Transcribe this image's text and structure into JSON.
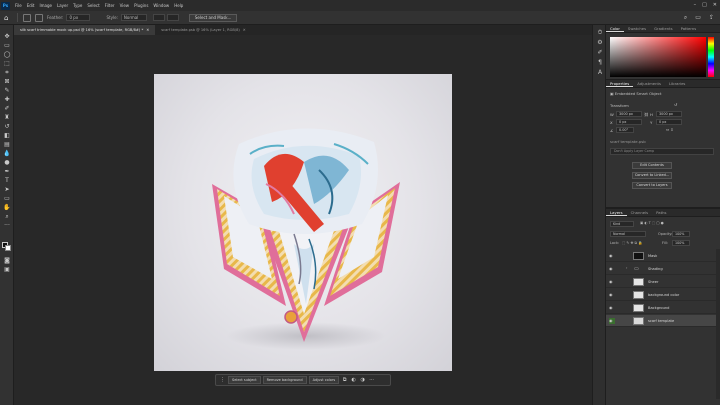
{
  "menubar": {
    "logo": "Ps",
    "items": [
      "File",
      "Edit",
      "Image",
      "Layer",
      "Type",
      "Select",
      "Filter",
      "View",
      "Plugins",
      "Window",
      "Help"
    ]
  },
  "options": {
    "feather_label": "Feather:",
    "feather_value": "0 px",
    "style_label": "Style:",
    "style_value": "Normal",
    "select_mask_label": "Select and Mask..."
  },
  "tabs": [
    {
      "label": "silk scarf trimmable mock up.psd @ 16% (scarf template, RGB/8#) *",
      "active": true
    },
    {
      "label": "scarf template.psb @ 16% (Layer 1, RGB/8)",
      "active": false
    }
  ],
  "context_bar": {
    "select_subject": "Select subject",
    "remove_background": "Remove background",
    "adjust_colors": "Adjust colors",
    "more": "···"
  },
  "color_panel": {
    "tabs": [
      "Color",
      "Swatches",
      "Gradients",
      "Patterns"
    ],
    "accent": "#ff0000"
  },
  "properties": {
    "tabs": [
      "Properties",
      "Adjustments",
      "Libraries"
    ],
    "type": "Embedded Smart Object",
    "transform_label": "Transform",
    "w": "3000 px",
    "h": "3000 px",
    "x": "0 px",
    "y": "0 px",
    "angle": "0.00°",
    "file_name": "scarf template.psb",
    "layer_comp": "Don't Apply Layer Comp",
    "edit_contents": "Edit Contents",
    "convert_to_linked": "Convert to Linked...",
    "convert_to_layers": "Convert to Layers"
  },
  "layers": {
    "tabs": [
      "Layers",
      "Channels",
      "Paths"
    ],
    "kind": "Kind",
    "blend_mode": "Normal",
    "opacity_label": "Opacity:",
    "opacity_value": "100%",
    "lock_label": "Lock:",
    "fill_label": "Fill:",
    "fill_value": "100%",
    "items": [
      {
        "name": "Mask",
        "type": "layer",
        "visible": true,
        "selected": false
      },
      {
        "name": "Shading",
        "type": "group",
        "visible": true,
        "selected": false
      },
      {
        "name": "Sheer",
        "type": "layer",
        "visible": true,
        "selected": false
      },
      {
        "name": "background color",
        "type": "layer",
        "visible": true,
        "selected": false
      },
      {
        "name": "Background",
        "type": "layer",
        "visible": true,
        "selected": false
      },
      {
        "name": "scarf template",
        "type": "smart",
        "visible": true,
        "selected": true
      }
    ]
  }
}
